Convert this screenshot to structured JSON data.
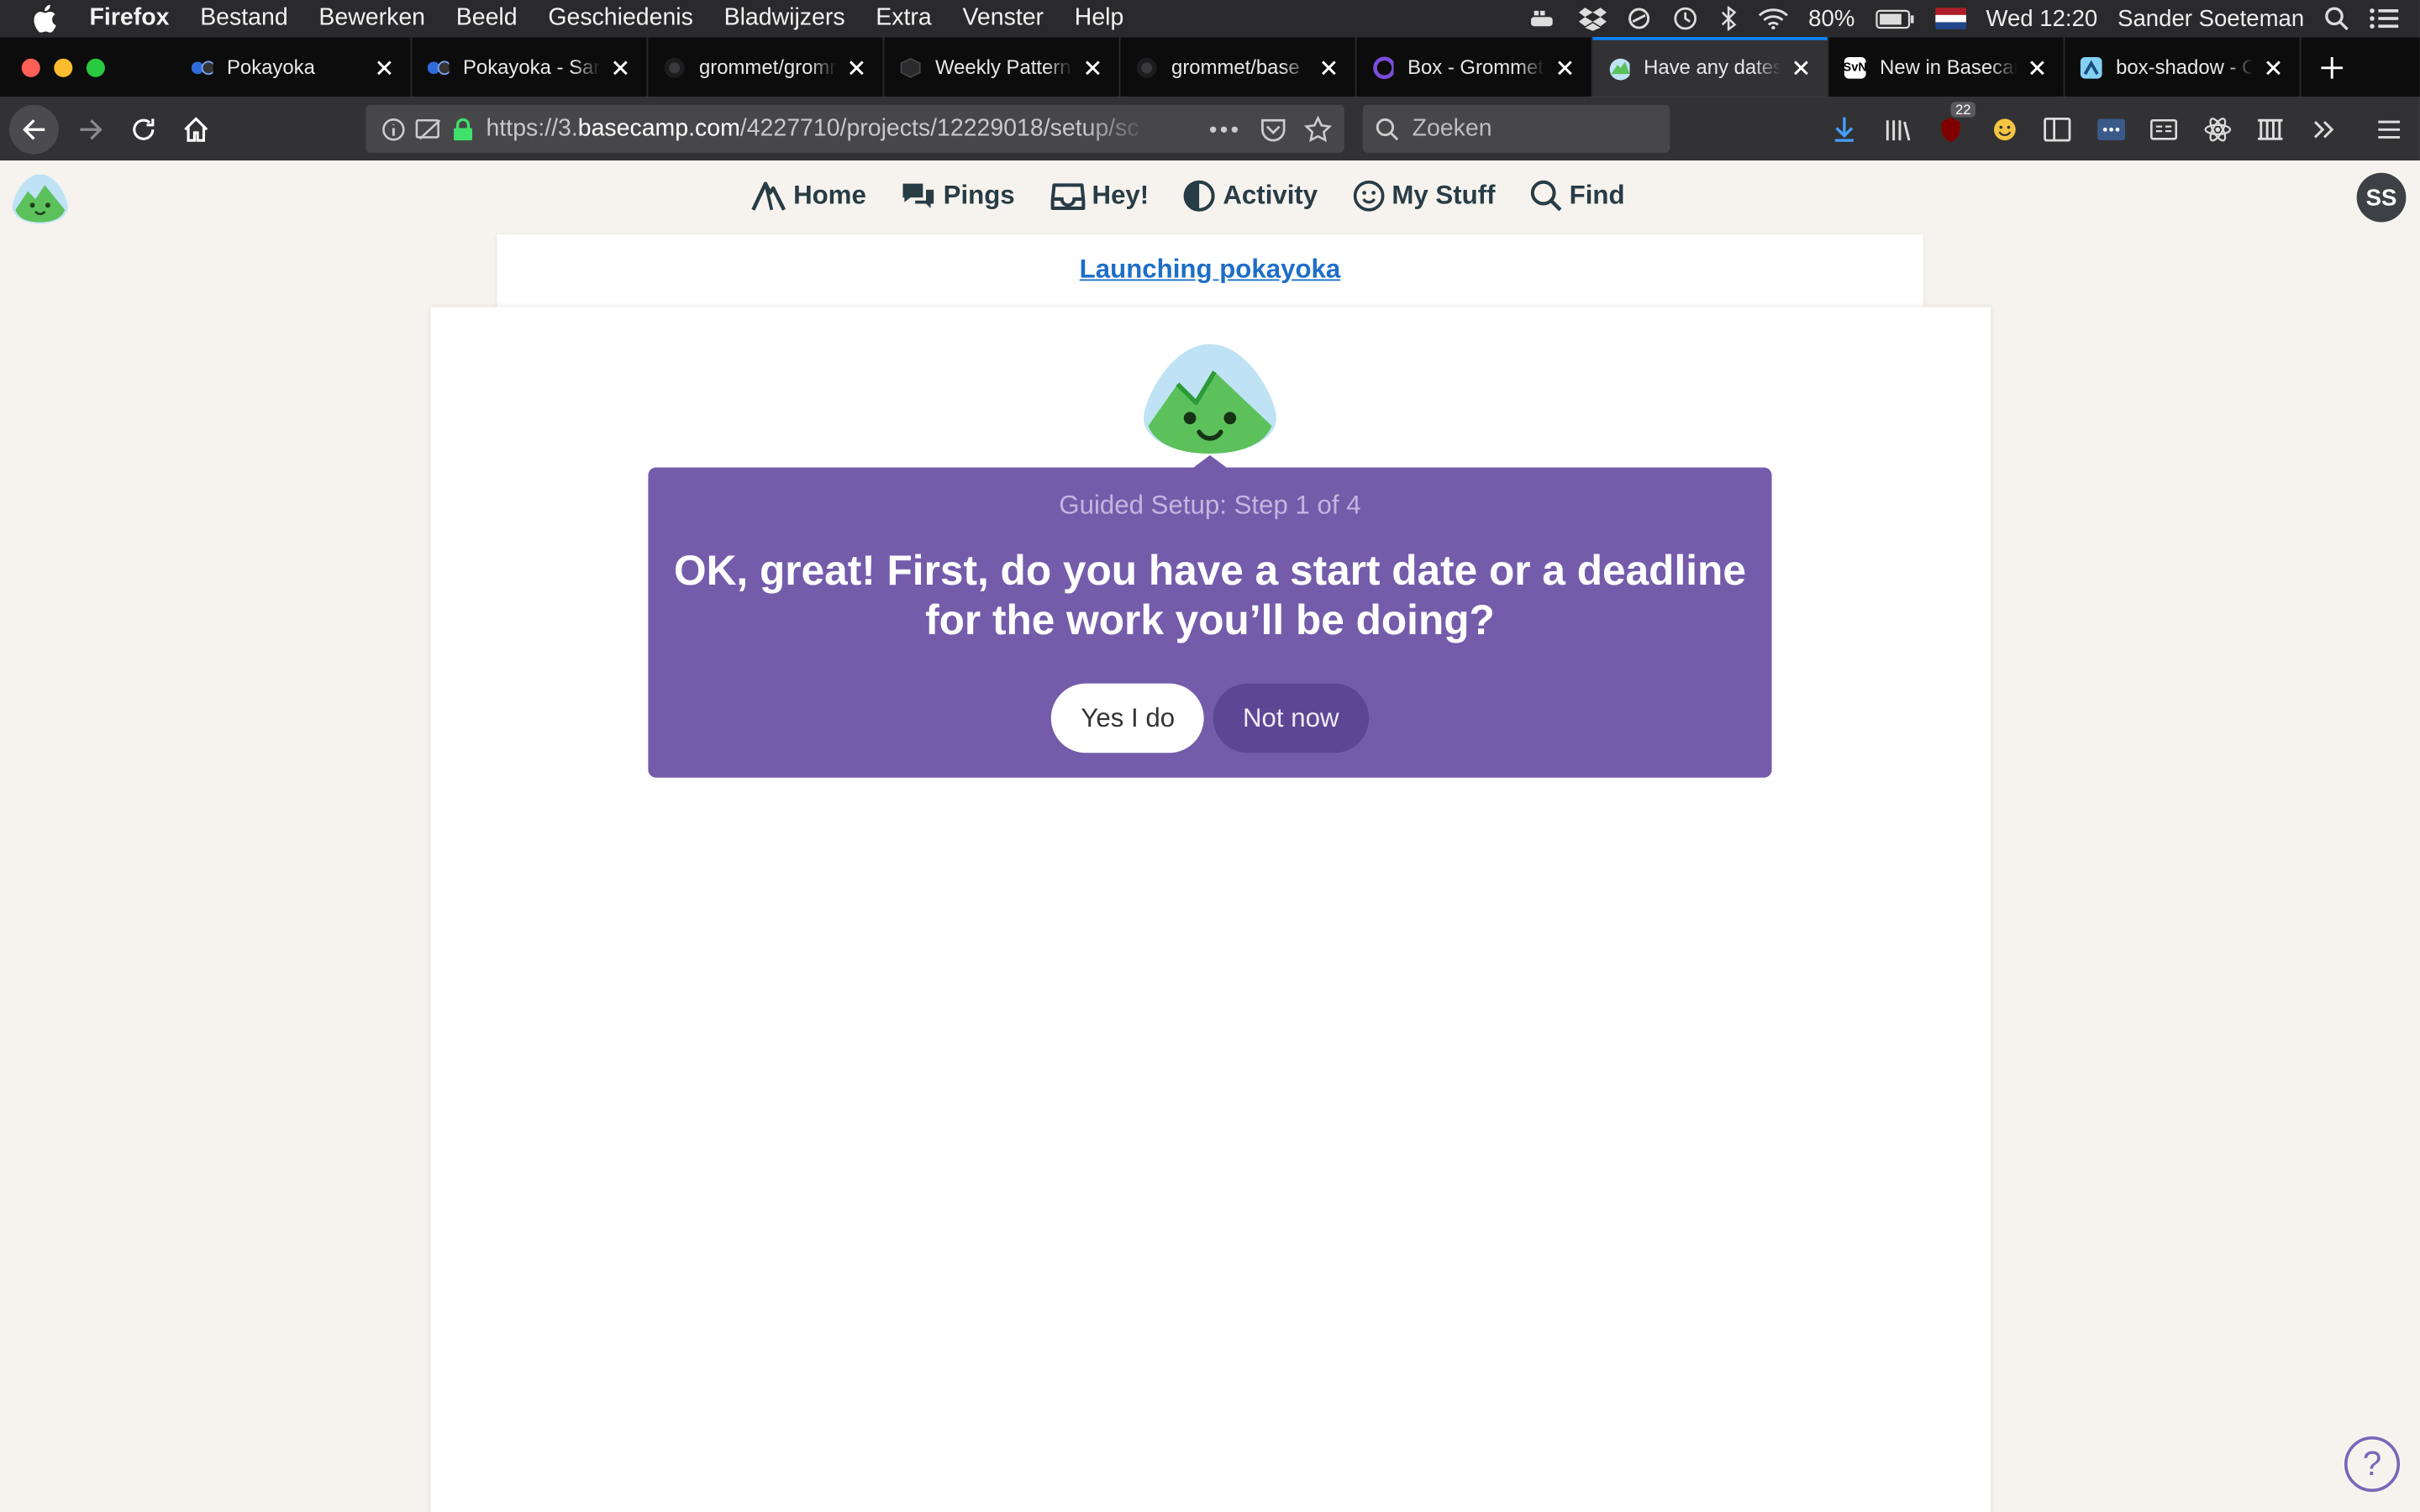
{
  "menubar": {
    "app": "Firefox",
    "items": [
      "Bestand",
      "Bewerken",
      "Beeld",
      "Geschiedenis",
      "Bladwijzers",
      "Extra",
      "Venster",
      "Help"
    ],
    "battery": "80%",
    "clock": "Wed 12:20",
    "user": "Sander Soeteman"
  },
  "tabs": [
    {
      "label": "Pokayoka",
      "fav": "Co"
    },
    {
      "label": "Pokayoka - Sander",
      "fav": "Co"
    },
    {
      "label": "grommet/grommet",
      "fav": ""
    },
    {
      "label": "Weekly Pattern",
      "fav": ""
    },
    {
      "label": "grommet/base",
      "fav": ""
    },
    {
      "label": "Box - Grommet",
      "fav": ""
    },
    {
      "label": "Have any dates",
      "fav": ""
    },
    {
      "label": "New in Basecamp",
      "fav": "SvN"
    },
    {
      "label": "box-shadow - CSS",
      "fav": ""
    }
  ],
  "navbar": {
    "url_prefix": "https://3.",
    "url_domain": "basecamp.com",
    "url_path": "/4227710/projects/12229018/setup/sc",
    "search_placeholder": "Zoeken",
    "badge_count": "22"
  },
  "bc": {
    "nav": {
      "home": "Home",
      "pings": "Pings",
      "hey": "Hey!",
      "activity": "Activity",
      "mystuff": "My Stuff",
      "find": "Find"
    },
    "avatar": "SS",
    "project_link": "Launching pokayoka",
    "setup": {
      "step": "Guided Setup: Step 1 of 4",
      "question": "OK, great! First, do you have a start date or a deadline for the work you’ll be doing?",
      "yes": "Yes I do",
      "no": "Not now"
    },
    "help": "?"
  },
  "colors": {
    "accent": "#0a84ff",
    "popup": "#745cab",
    "link": "#1e6ec8"
  }
}
